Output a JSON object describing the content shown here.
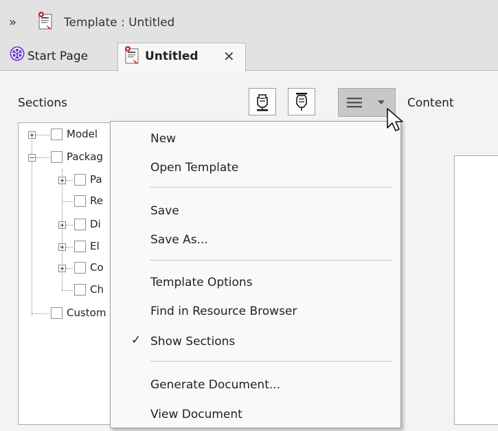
{
  "titlebar": {
    "title": "Template : Untitled",
    "expand_glyph": "»",
    "icon": "template-doc-icon"
  },
  "tabs": [
    {
      "label": "Start Page",
      "icon": "start-page-icon",
      "active": false
    },
    {
      "label": "Untitled",
      "icon": "template-doc-icon",
      "active": true,
      "close_glyph": "✕"
    }
  ],
  "sections": {
    "label": "Sections"
  },
  "content": {
    "label": "Content"
  },
  "toolbar": {
    "buttons": [
      {
        "icon": "pen-edit-icon"
      },
      {
        "icon": "pen-alt-icon"
      }
    ],
    "menu_button": {
      "icon": "hamburger-dropdown-icon"
    }
  },
  "tree": {
    "items": [
      {
        "label": "Model",
        "expander": "+",
        "level": 0
      },
      {
        "label": "Packag",
        "expander": "−",
        "level": 0
      },
      {
        "label": "Pa",
        "expander": "+",
        "level": 1
      },
      {
        "label": "Re",
        "expander": "",
        "level": 1
      },
      {
        "label": "Di",
        "expander": "+",
        "level": 1
      },
      {
        "label": "El",
        "expander": "+",
        "level": 1
      },
      {
        "label": "Co",
        "expander": "+",
        "level": 1
      },
      {
        "label": "Ch",
        "expander": "",
        "level": 1
      },
      {
        "label": "Custom",
        "expander": "",
        "level": 0
      }
    ]
  },
  "menu": {
    "items": [
      {
        "label": "New",
        "checked": false
      },
      {
        "label": "Open Template",
        "checked": false
      },
      {
        "label": "Save",
        "checked": false
      },
      {
        "label": "Save As...",
        "checked": false
      },
      {
        "label": "Template Options",
        "checked": false
      },
      {
        "label": "Find in Resource Browser",
        "checked": false
      },
      {
        "label": "Show Sections",
        "checked": true
      },
      {
        "label": "Generate Document...",
        "checked": false
      },
      {
        "label": "View Document",
        "checked": false
      }
    ],
    "check_glyph": "✓"
  }
}
